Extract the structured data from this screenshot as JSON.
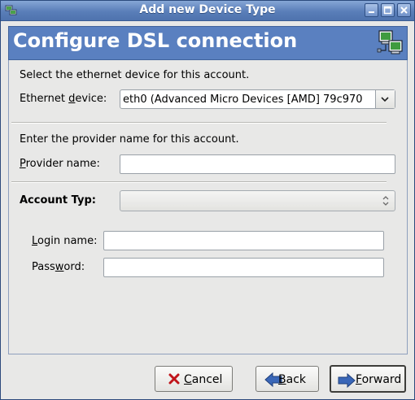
{
  "window": {
    "title": "Add new Device Type"
  },
  "header": {
    "title": "Configure DSL connection",
    "icon": "network-computers-icon"
  },
  "ethernet_section": {
    "prompt": "Select the ethernet device for this account.",
    "device_label_pre": "Ethernet ",
    "device_label_mnemonic": "d",
    "device_label_post": "evice:",
    "device_value": "eth0 (Advanced Micro Devices [AMD] 79c970"
  },
  "provider_section": {
    "prompt": "Enter the provider name for this account.",
    "label_mnemonic": "P",
    "label_post": "rovider name:",
    "value": ""
  },
  "account_type": {
    "label": "Account Typ:",
    "value": ""
  },
  "login": {
    "label_pre": "",
    "label_mnemonic": "L",
    "label_post": "ogin name:",
    "value": ""
  },
  "password": {
    "label_pre": "Pass",
    "label_mnemonic": "w",
    "label_post": "ord:",
    "value": ""
  },
  "buttons": {
    "cancel": {
      "mnemonic": "C",
      "rest": "ancel",
      "icon": "x-icon"
    },
    "back": {
      "mnemonic": "B",
      "rest": "ack",
      "icon": "left-arrow-icon"
    },
    "forward": {
      "mnemonic": "F",
      "rest": "orward",
      "icon": "right-arrow-icon"
    }
  },
  "colors": {
    "titlebar": "#5a7eb8",
    "header_bg": "#5a80c0",
    "window_bg": "#e8e8e7",
    "cancel_icon": "#c0141a",
    "arrow_icon": "#3a67b8"
  }
}
